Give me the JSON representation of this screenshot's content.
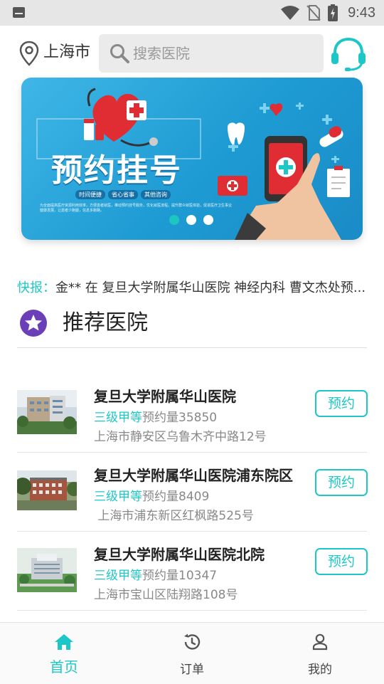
{
  "status_bar": {
    "time": "9:43"
  },
  "header": {
    "city": "上海市",
    "search_placeholder": "搜索医院"
  },
  "banner": {
    "title": "预约挂号",
    "tags": [
      "时间便捷",
      "省心省事",
      "其他咨询"
    ],
    "description": "为全面提高医疗资源利用效率，方便患者就医，推动预约挂号服务，优化就医流程，提升群众就医体验，促进医疗卫生事业健康发展，让患者少跑腿，信息多跑路。",
    "active_slide": 0,
    "slide_count": 3
  },
  "news": {
    "label": "快报：",
    "text": "金** 在 复旦大学附属华山医院 神经内科 曹文杰处预..."
  },
  "recommend": {
    "title": "推荐医院",
    "hospitals": [
      {
        "name": "复旦大学附属华山医院",
        "level": "三级甲等",
        "count_label": "预约量",
        "count": "35850",
        "address": "上海市静安区乌鲁木齐中路12号",
        "button": "预约"
      },
      {
        "name": "复旦大学附属华山医院浦东院区",
        "level": "三级甲等",
        "count_label": "预约量",
        "count": "8409",
        "address": " 上海市浦东新区红枫路525号",
        "button": "预约"
      },
      {
        "name": "复旦大学附属华山医院北院",
        "level": "三级甲等",
        "count_label": "预约量",
        "count": "10347",
        "address": "上海市宝山区陆翔路108号",
        "button": "预约"
      }
    ]
  },
  "bottom_nav": {
    "items": [
      {
        "label": "首页",
        "icon": "home-icon",
        "active": true
      },
      {
        "label": "订单",
        "icon": "history-icon",
        "active": false
      },
      {
        "label": "我的",
        "icon": "user-icon",
        "active": false
      }
    ]
  },
  "colors": {
    "accent": "#1ec7c7",
    "star_badge": "#6b3fb8",
    "banner_blue": "#1e9bd3"
  }
}
